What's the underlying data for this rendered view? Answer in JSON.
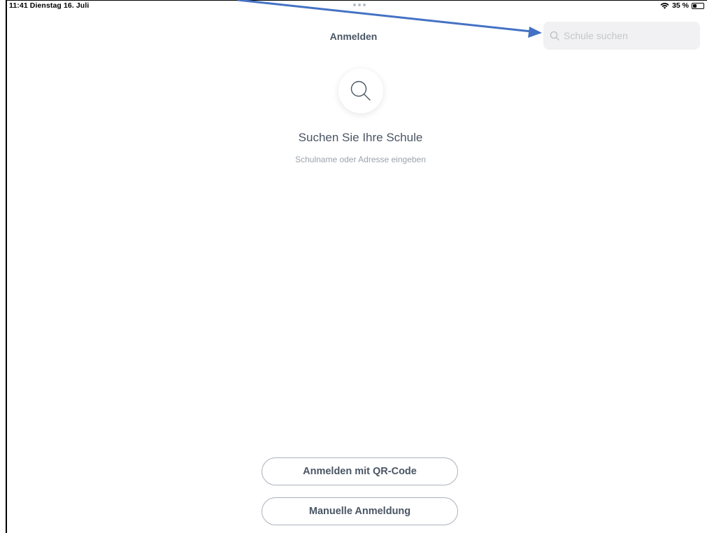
{
  "status_bar": {
    "time_date": "11:41  Dienstag 16. Juli",
    "battery": "35 %"
  },
  "header": {
    "title": "Anmelden"
  },
  "search": {
    "placeholder": "Schule suchen",
    "value": ""
  },
  "hero": {
    "icon": "search-icon",
    "title": "Suchen Sie Ihre Schule",
    "subtitle": "Schulname oder Adresse eingeben"
  },
  "buttons": {
    "qr_label": "Anmelden mit QR-Code",
    "manual_label": "Manuelle Anmeldung"
  },
  "colors": {
    "text": "#4a5564",
    "muted": "#9aa3ad",
    "annotation_arrow": "#4472c4",
    "search_bg": "#f1f1f3"
  }
}
